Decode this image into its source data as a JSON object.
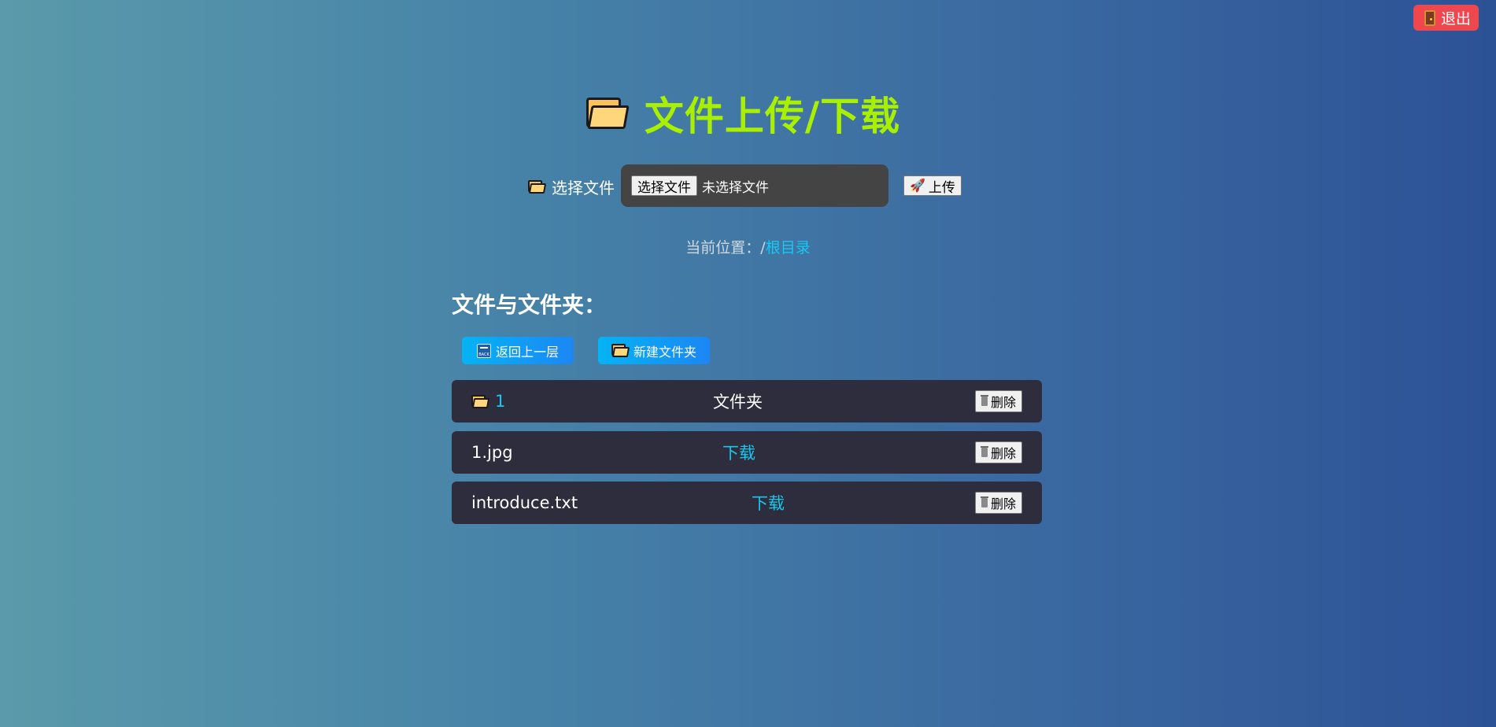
{
  "header": {
    "logout_label": "退出",
    "title": "文件上传/下载"
  },
  "upload": {
    "choose_label": "选择文件",
    "file_button_label": "选择文件",
    "no_file_text": "未选择文件",
    "upload_button_label": "上传"
  },
  "location": {
    "prefix": "当前位置：/",
    "root_label": "根目录"
  },
  "section": {
    "heading": "文件与文件夹："
  },
  "actions": {
    "back_label": "返回上一层",
    "back_icon_text": "BACK",
    "new_folder_label": "新建文件夹"
  },
  "files": [
    {
      "name": "1",
      "kind": "folder",
      "middle_text": "文件夹",
      "delete_label": "删除"
    },
    {
      "name": "1.jpg",
      "kind": "file",
      "middle_text": "下载",
      "delete_label": "删除"
    },
    {
      "name": "introduce.txt",
      "kind": "file",
      "middle_text": "下载",
      "delete_label": "删除"
    }
  ],
  "colors": {
    "title": "#a8f000",
    "link": "#17c8f0",
    "logout_bg": "#f0474f",
    "row_bg": "#2d2d3d"
  }
}
